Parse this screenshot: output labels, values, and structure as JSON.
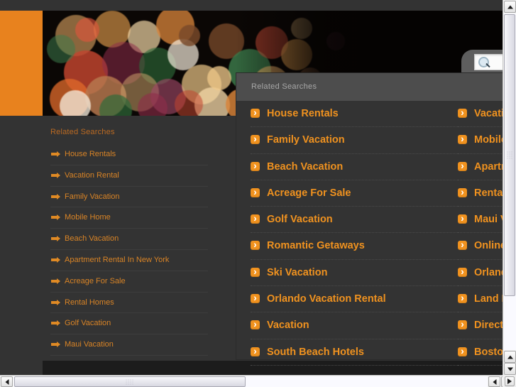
{
  "page": {
    "background_color": "#333333",
    "accent_color": "#e8821e",
    "link_color": "#f0921f"
  },
  "search": {
    "placeholder": "",
    "value": "",
    "icon": "magnifier-icon"
  },
  "background_panel": {
    "heading": "Related Searches",
    "items": [
      {
        "label": "House Rentals"
      },
      {
        "label": "Vacation Rental"
      },
      {
        "label": "Family Vacation"
      },
      {
        "label": "Mobile Home"
      },
      {
        "label": "Beach Vacation"
      },
      {
        "label": "Apartment Rental In New York"
      },
      {
        "label": "Acreage For Sale"
      },
      {
        "label": "Rental Homes"
      },
      {
        "label": "Golf Vacation"
      },
      {
        "label": "Maui Vacation"
      }
    ]
  },
  "overlay_panel": {
    "title": "Related Searches",
    "left_column": [
      {
        "label": "House Rentals",
        "icon": "chevron-right-icon"
      },
      {
        "label": "Family Vacation",
        "icon": "chevron-right-icon"
      },
      {
        "label": "Beach Vacation",
        "icon": "chevron-right-icon"
      },
      {
        "label": "Acreage For Sale",
        "icon": "chevron-right-icon"
      },
      {
        "label": "Golf Vacation",
        "icon": "chevron-right-icon"
      },
      {
        "label": "Romantic Getaways",
        "icon": "chevron-right-icon"
      },
      {
        "label": "Ski Vacation",
        "icon": "chevron-right-icon"
      },
      {
        "label": "Orlando Vacation Rental",
        "icon": "chevron-right-icon"
      },
      {
        "label": "Vacation",
        "icon": "chevron-right-icon"
      },
      {
        "label": "South Beach Hotels",
        "icon": "chevron-right-icon"
      }
    ],
    "right_column": [
      {
        "label": "Vacation Rental",
        "icon": "chevron-right-icon"
      },
      {
        "label": "Mobile Home",
        "icon": "chevron-right-icon"
      },
      {
        "label": "Apartment Rental In New York",
        "icon": "chevron-right-icon"
      },
      {
        "label": "Rental Homes",
        "icon": "chevron-right-icon"
      },
      {
        "label": "Maui Vacation",
        "icon": "chevron-right-icon"
      },
      {
        "label": "Online Vacation",
        "icon": "chevron-right-icon"
      },
      {
        "label": "Orlando Vacation",
        "icon": "chevron-right-icon"
      },
      {
        "label": "Land For Sale",
        "icon": "chevron-right-icon"
      },
      {
        "label": "Direct Travel",
        "icon": "chevron-right-icon"
      },
      {
        "label": "Boston Hotels",
        "icon": "chevron-right-icon"
      }
    ]
  },
  "scrollbars": {
    "vertical": {
      "up_arrow": "triangle-up-icon",
      "down_arrow": "triangle-down-icon",
      "second_down_arrow": "triangle-down-icon"
    },
    "horizontal": {
      "left_arrow": "triangle-left-icon",
      "right_arrow": "triangle-right-icon",
      "second_right_arrow": "triangle-right-icon"
    },
    "resize_grip": "resize-grip-icon"
  }
}
